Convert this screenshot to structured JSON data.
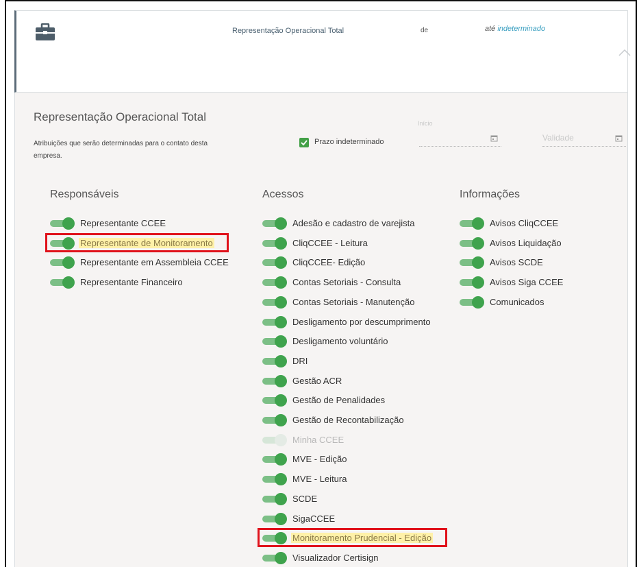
{
  "header": {
    "title": "Representação Operacional Total",
    "de_label": "de",
    "ate_label": "até",
    "ate_value": "indeterminado"
  },
  "panel": {
    "title": "Representação Operacional Total",
    "description": "Atribuições que serão determinadas para o contato desta empresa.",
    "prazo_label": "Prazo indeterminado",
    "prazo_checked": true,
    "inicio_label": "Início",
    "inicio_value": "",
    "validade_placeholder": "Validade"
  },
  "columns": {
    "responsaveis": {
      "title": "Responsáveis",
      "items": [
        {
          "label": "Representante CCEE",
          "on": true
        },
        {
          "label": "Representante de Monitoramento",
          "on": true,
          "highlighted": true
        },
        {
          "label": "Representante em Assembleia CCEE",
          "on": true
        },
        {
          "label": "Representante Financeiro",
          "on": true
        }
      ]
    },
    "acessos": {
      "title": "Acessos",
      "items": [
        {
          "label": "Adesão e cadastro de varejista",
          "on": true
        },
        {
          "label": "CliqCCEE - Leitura",
          "on": true
        },
        {
          "label": "CliqCCEE- Edição",
          "on": true
        },
        {
          "label": "Contas Setoriais - Consulta",
          "on": true
        },
        {
          "label": "Contas Setoriais - Manutenção",
          "on": true
        },
        {
          "label": "Desligamento por descumprimento",
          "on": true
        },
        {
          "label": "Desligamento voluntário",
          "on": true
        },
        {
          "label": "DRI",
          "on": true
        },
        {
          "label": "Gestão ACR",
          "on": true
        },
        {
          "label": "Gestão de Penalidades",
          "on": true
        },
        {
          "label": "Gestão de Recontabilização",
          "on": true
        },
        {
          "label": "Minha CCEE",
          "on": false,
          "disabled": true
        },
        {
          "label": "MVE - Edição",
          "on": true
        },
        {
          "label": "MVE - Leitura",
          "on": true
        },
        {
          "label": "SCDE",
          "on": true
        },
        {
          "label": "SigaCCEE",
          "on": true
        },
        {
          "label": "Monitoramento Prudencial - Edição",
          "on": true,
          "highlighted": true
        },
        {
          "label": "Visualizador Certisign",
          "on": true
        }
      ]
    },
    "informacoes": {
      "title": "Informações",
      "items": [
        {
          "label": "Avisos CliqCCEE",
          "on": true
        },
        {
          "label": "Avisos Liquidação",
          "on": true
        },
        {
          "label": "Avisos SCDE",
          "on": true
        },
        {
          "label": "Avisos Siga CCEE",
          "on": true
        },
        {
          "label": "Comunicados",
          "on": true
        }
      ]
    }
  },
  "colors": {
    "toggle_on": "#3fa34d",
    "toggle_track_on": "#7cbf86",
    "highlight": "#fff1a8",
    "annotation_red": "#e0121b",
    "link_blue": "#3a9fc0"
  },
  "icons": {
    "header": "briefcase-icon",
    "collapse": "chevron-up-icon",
    "date": "calendar-icon",
    "check": "check-icon"
  }
}
